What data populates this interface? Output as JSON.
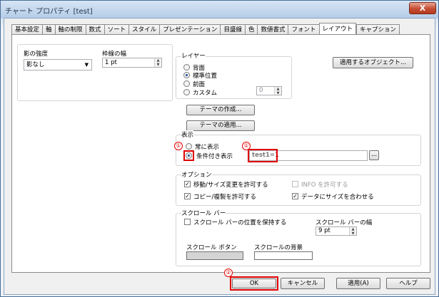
{
  "window": {
    "title": "チャート プロパティ [test]",
    "close_label": "X"
  },
  "tabs": [
    "基本設定",
    "軸",
    "軸の制限",
    "数式",
    "ソート",
    "スタイル",
    "プレゼンテーション",
    "目盛線",
    "色",
    "数値書式",
    "フォント",
    "レイアウト",
    "キャプション"
  ],
  "active_tab": "レイアウト",
  "shadow": {
    "label": "影の強度",
    "value": "影なし"
  },
  "border_width": {
    "label": "枠線の幅",
    "value": "1 pt"
  },
  "layer": {
    "label": "レイヤー",
    "options": [
      "背面",
      "標準位置",
      "前面",
      "カスタム"
    ],
    "selected": "標準位置",
    "custom_value": "0"
  },
  "apply_to_objects_label": "適用するオブジェクト...",
  "theme": {
    "create_label": "テーマの作成...",
    "apply_label": "テーマの適用..."
  },
  "display": {
    "label": "表示",
    "options": [
      "常に表示",
      "条件付き表示"
    ],
    "selected": "条件付き表示",
    "condition_value": "test1=1",
    "ellipsis_label": "...",
    "annotation": "①"
  },
  "options": {
    "label": "オプション",
    "items": [
      {
        "label": "移動/サイズ変更を許可する",
        "checked": true,
        "enabled": true
      },
      {
        "label": "INFO を許可する",
        "checked": false,
        "enabled": false
      },
      {
        "label": "コピー/複製を許可する",
        "checked": true,
        "enabled": true
      },
      {
        "label": "データにサイズを合わせる",
        "checked": true,
        "enabled": true
      }
    ]
  },
  "scrollbar": {
    "label": "スクロール バー",
    "keep_position_label": "スクロール バーの位置を保持する",
    "keep_position_checked": false,
    "width_label": "スクロール バーの幅",
    "width_value": "9 pt",
    "button_label": "スクロール ボタン",
    "background_label": "スクロールの背景",
    "button_color": "#d4d4d4",
    "background_color": "#ffffff"
  },
  "footer": {
    "ok": "OK",
    "cancel": "キャンセル",
    "apply": "適用(A)",
    "help": "ヘルプ",
    "annotation": "②"
  },
  "colors": {
    "annotation_red": "#e00000",
    "title_bar": "#b6cde8"
  }
}
